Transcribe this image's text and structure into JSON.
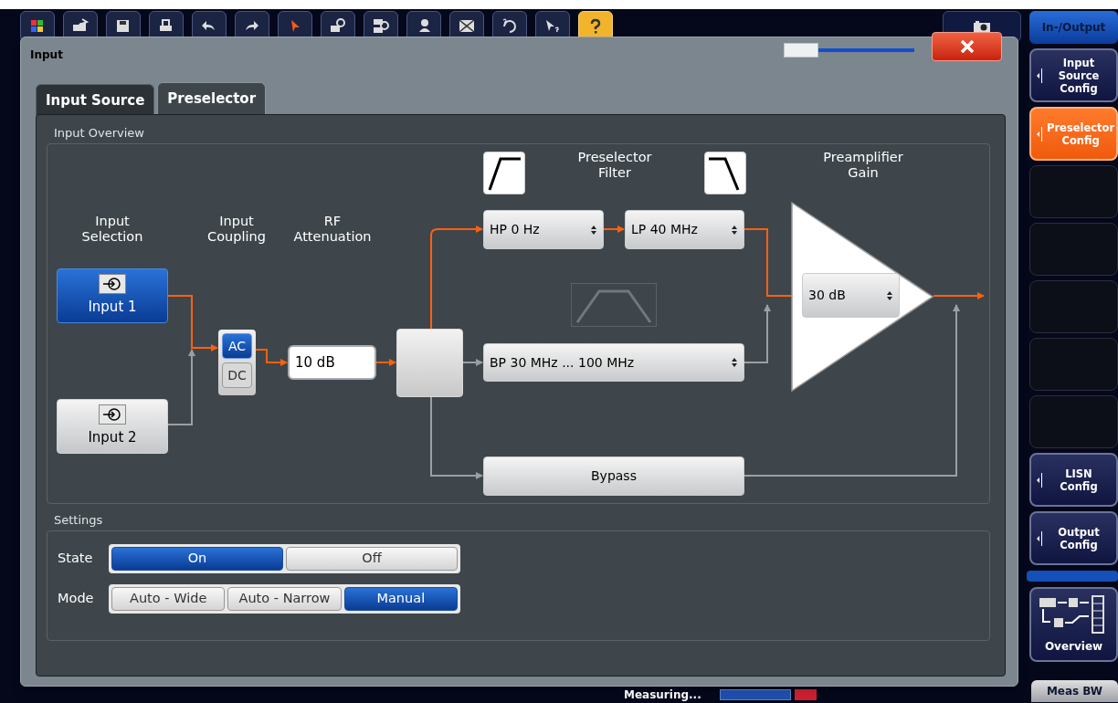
{
  "toolbar": {
    "buttons": [
      {
        "highlighted": false
      },
      {
        "highlighted": false
      },
      {
        "highlighted": false
      },
      {
        "highlighted": false
      },
      {
        "highlighted": false
      },
      {
        "highlighted": false
      },
      {
        "highlighted": false
      },
      {
        "highlighted": false
      },
      {
        "highlighted": false
      },
      {
        "highlighted": false
      },
      {
        "highlighted": false
      },
      {
        "highlighted": false
      },
      {
        "highlighted": false
      },
      {
        "highlighted": true
      }
    ]
  },
  "dialog": {
    "title": "Input",
    "transparency": {
      "level": 0
    },
    "tabs": [
      {
        "label": "Input Source",
        "selected": false
      },
      {
        "label": "Preselector",
        "selected": true
      }
    ],
    "input_overview": {
      "title": "Input Overview",
      "input_selection": {
        "title": "Input Selection",
        "inputs": [
          {
            "label": "Input 1",
            "selected": true
          },
          {
            "label": "Input 2",
            "selected": false
          }
        ]
      },
      "input_coupling": {
        "title": "Input Coupling",
        "options": [
          {
            "label": "AC",
            "selected": true
          },
          {
            "label": "DC",
            "selected": false
          }
        ]
      },
      "rf_attenuation": {
        "title": "RF Attenuation",
        "value": "10 dB"
      },
      "preselector_filter": {
        "title": "Preselector Filter",
        "highpass": "HP 0 Hz",
        "lowpass": "LP 40 MHz",
        "bandpass": "BP 30 MHz ... 100 MHz"
      },
      "bypass": "Bypass",
      "preamplifier": {
        "title": "Preamplifier Gain",
        "value": "30 dB"
      }
    },
    "settings": {
      "title": "Settings",
      "rows": [
        {
          "label": "State",
          "options": [
            {
              "label": "On",
              "selected": true
            },
            {
              "label": "Off",
              "selected": false
            }
          ]
        },
        {
          "label": "Mode",
          "options": [
            {
              "label": "Auto - Wide",
              "selected": false
            },
            {
              "label": "Auto - Narrow",
              "selected": false
            },
            {
              "label": "Manual",
              "selected": true
            }
          ]
        }
      ]
    }
  },
  "sidebar": {
    "title": "In-/Output",
    "softkeys": [
      {
        "kind": "config",
        "label": "Input Source Config",
        "selected": false
      },
      {
        "kind": "config",
        "label": "Preselector Config",
        "selected": true
      },
      {
        "kind": "empty"
      },
      {
        "kind": "empty"
      },
      {
        "kind": "empty"
      },
      {
        "kind": "empty"
      },
      {
        "kind": "empty"
      },
      {
        "kind": "config",
        "label": "LISN Config",
        "selected": false
      },
      {
        "kind": "config",
        "label": "Output Config",
        "selected": false
      },
      {
        "kind": "overview",
        "label": "Overview"
      }
    ]
  },
  "status_bar": {
    "message": "Measuring...",
    "tab": "Meas BW"
  }
}
